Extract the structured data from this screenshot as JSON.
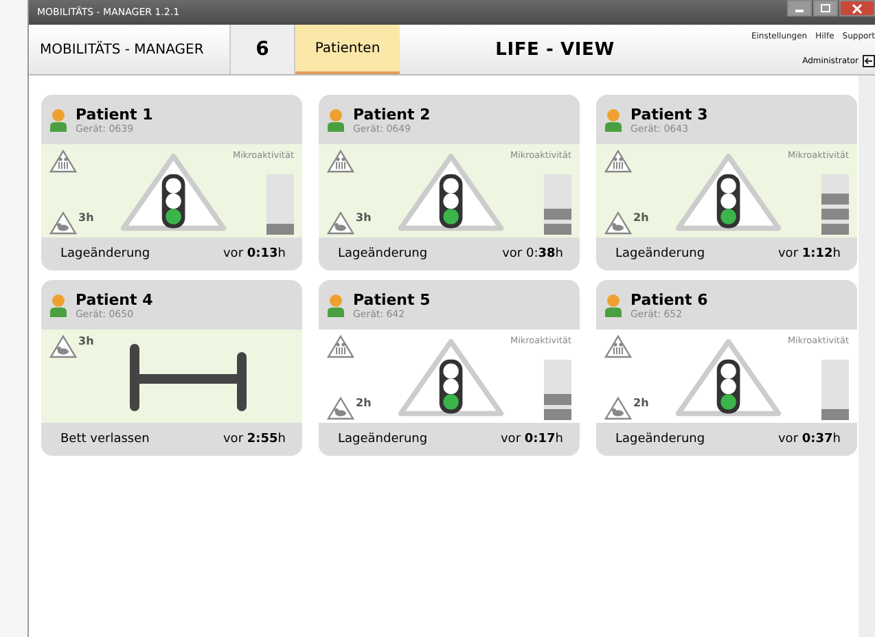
{
  "window": {
    "title": "MOBILITÄTS - MANAGER 1.2.1"
  },
  "header": {
    "app_name": "MOBILITÄTS - MANAGER",
    "patient_count": "6",
    "patients_tab": "Patienten",
    "view_title": "LIFE - VIEW",
    "links": [
      "Einstellungen",
      "Hilfe",
      "Support"
    ],
    "user": "Administrator"
  },
  "patients": [
    {
      "name": "Patient 1",
      "device": "Gerät: 0639",
      "kind": "traffic",
      "highlighted": true,
      "activity_label": "Mikroaktivität",
      "level": 0.25,
      "warnings": [
        {
          "kind": "person"
        },
        {
          "kind": "lying",
          "label": "3h"
        }
      ],
      "event": "Lageänderung",
      "time": "vor **0:13**h"
    },
    {
      "name": "Patient 2",
      "device": "Gerät: 0649",
      "kind": "traffic",
      "highlighted": true,
      "activity_label": "Mikroaktivität",
      "level": 0.5,
      "warnings": [
        {
          "kind": "person"
        },
        {
          "kind": "lying",
          "label": "3h"
        }
      ],
      "event": "Lageänderung",
      "time": "vor 0:**38**h"
    },
    {
      "name": "Patient 3",
      "device": "Gerät: 0643",
      "kind": "traffic",
      "highlighted": true,
      "activity_label": "Mikroaktivität",
      "level": 0.75,
      "warnings": [
        {
          "kind": "person"
        },
        {
          "kind": "lying",
          "label": "2h"
        }
      ],
      "event": "Lageänderung",
      "time": "vor **1:12**h"
    },
    {
      "name": "Patient 4",
      "device": "Gerät: 0650",
      "kind": "bed",
      "highlighted": true,
      "warnings": [
        {
          "kind": "lying",
          "label": "3h"
        }
      ],
      "event": "Bett verlassen",
      "time": "vor **2:55**h"
    },
    {
      "name": "Patient 5",
      "device": "Gerät: 642",
      "kind": "traffic",
      "highlighted": false,
      "activity_label": "Mikroaktivität",
      "level": 0.5,
      "warnings": [
        {
          "kind": "person"
        },
        {
          "kind": "lying",
          "label": "2h"
        }
      ],
      "event": "Lageänderung",
      "time": "vor **0:17**h"
    },
    {
      "name": "Patient 6",
      "device": "Gerät: 652",
      "kind": "traffic",
      "highlighted": false,
      "activity_label": "Mikroaktivität",
      "level": 0.25,
      "warnings": [
        {
          "kind": "person"
        },
        {
          "kind": "lying",
          "label": "2h"
        }
      ],
      "event": "Lageänderung",
      "time": "vor **0:37**h"
    }
  ]
}
